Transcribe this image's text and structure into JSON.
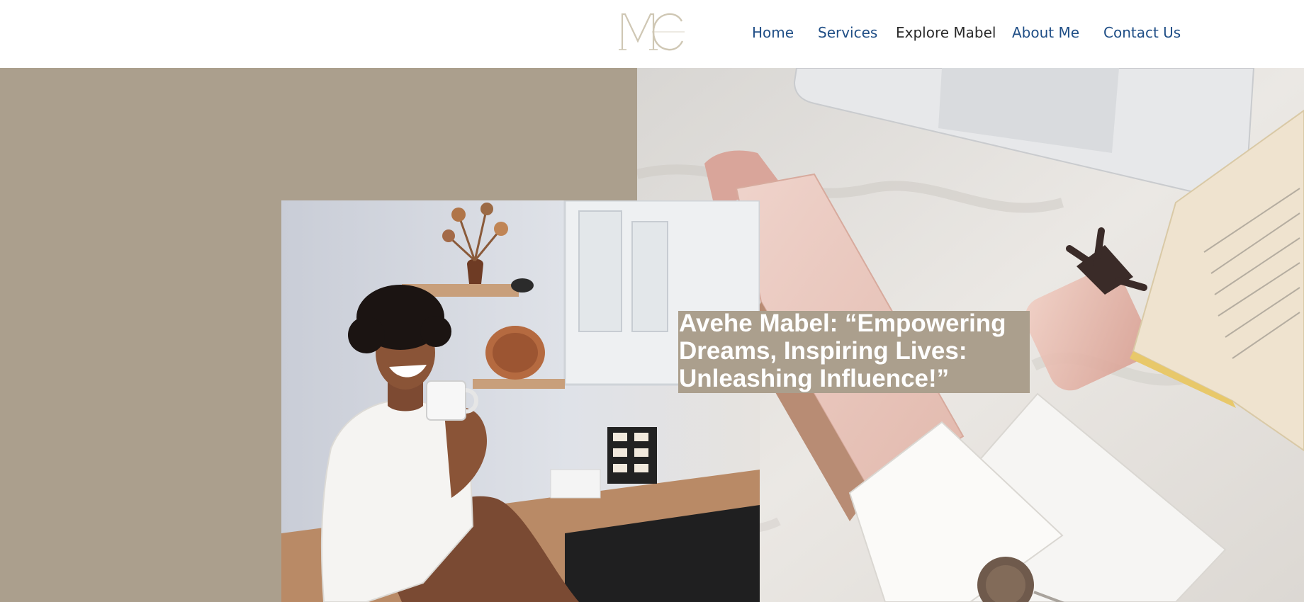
{
  "header": {
    "logo_text": "MC",
    "nav": [
      {
        "label": "Home",
        "active": false
      },
      {
        "label": "Services",
        "active": false
      },
      {
        "label": "Explore Mabel",
        "active": true
      },
      {
        "label": "About Me",
        "active": false
      },
      {
        "label": "Contact Us",
        "active": false
      }
    ]
  },
  "hero": {
    "headline": "Avehe Mabel: “Empowering Dreams, Inspiring Lives: Unleashing Influence!”",
    "colors": {
      "panel": "#ab9f8d",
      "nav_link": "#1f4e86",
      "nav_active": "#2b2b2b",
      "headline_text": "#ffffff"
    }
  }
}
